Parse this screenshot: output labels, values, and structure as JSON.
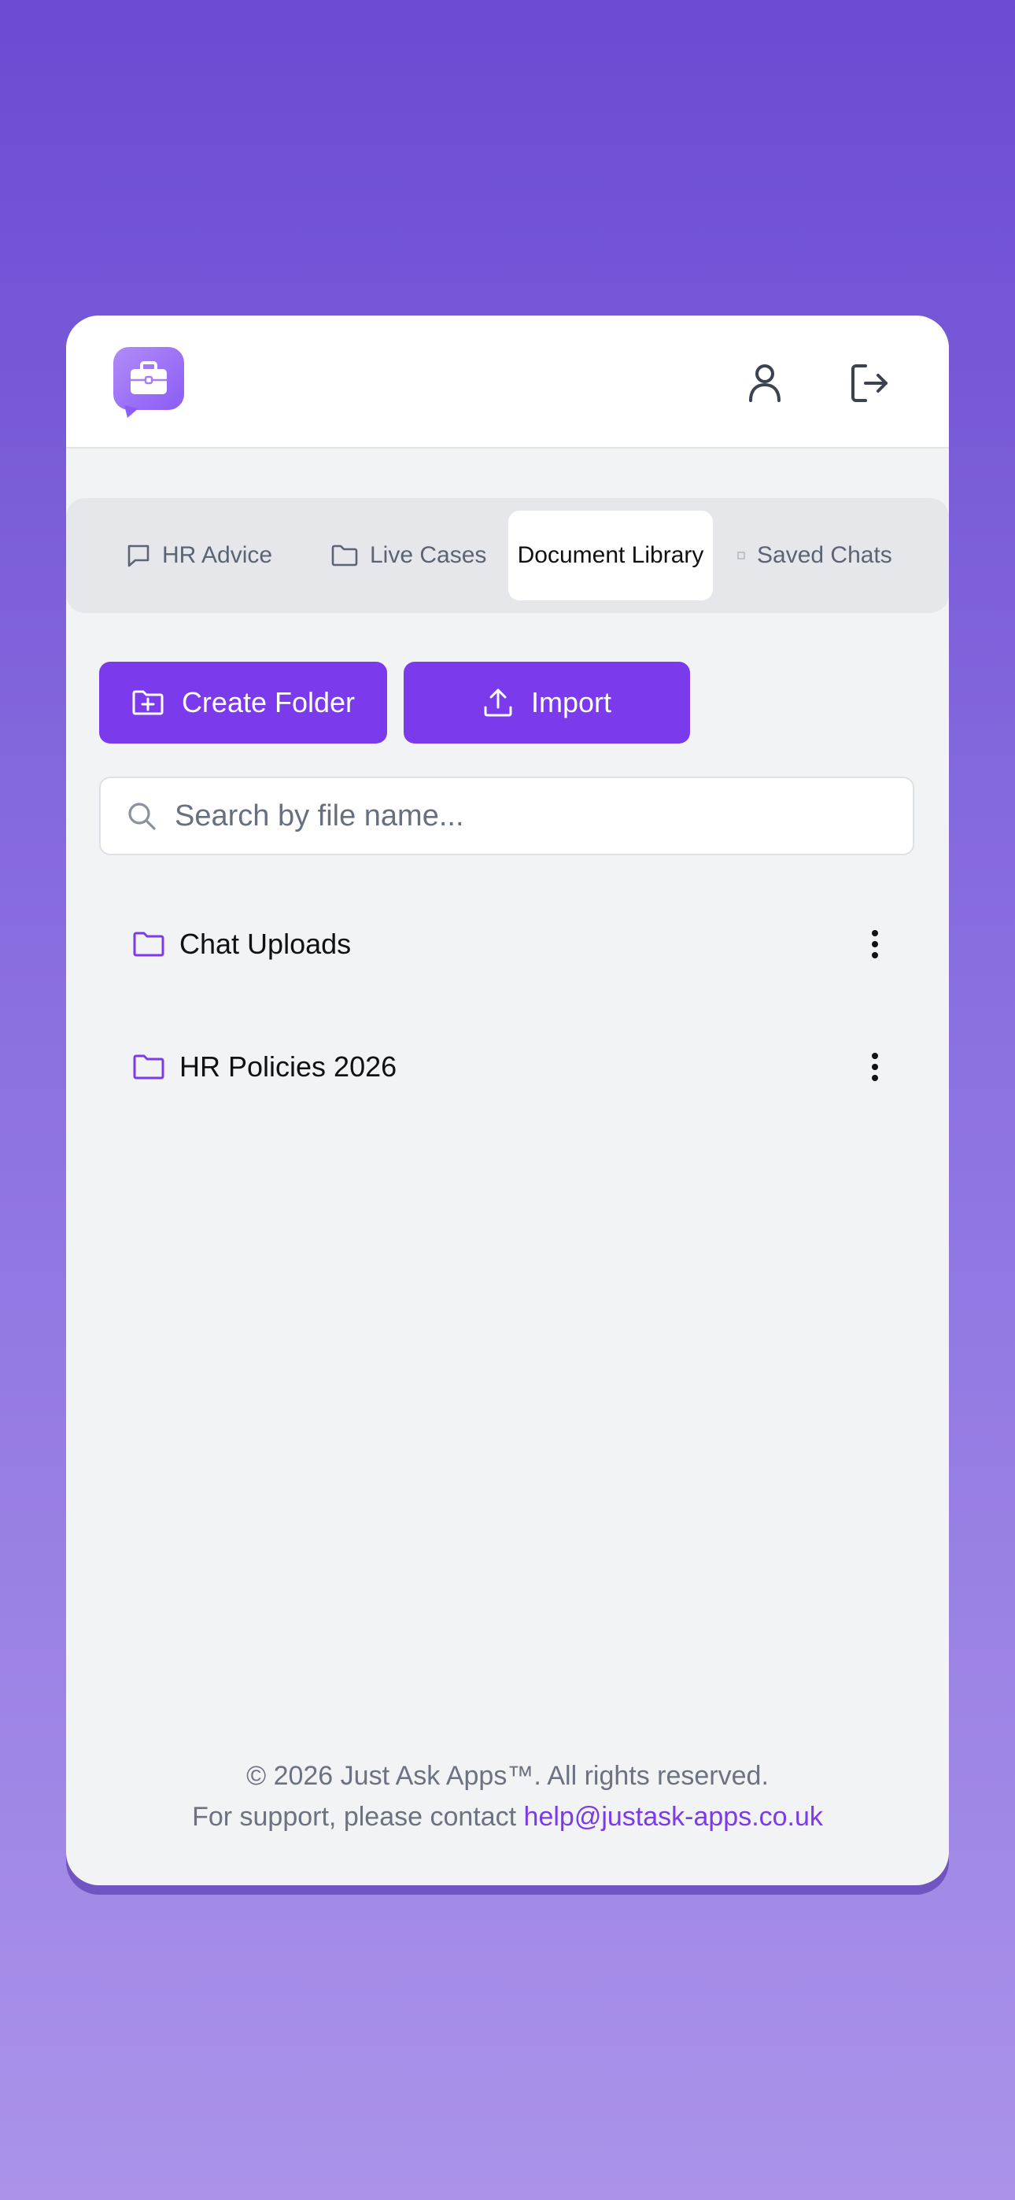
{
  "header": {
    "logo_icon": "briefcase-chat-icon",
    "profile_icon": "user-icon",
    "logout_icon": "logout-icon"
  },
  "tabs": [
    {
      "label": "HR Advice",
      "icon": "chat-bubble-icon",
      "active": false
    },
    {
      "label": "Live Cases",
      "icon": "folder-icon",
      "active": false
    },
    {
      "label": "Document Library",
      "icon": "",
      "active": true
    },
    {
      "label": "Saved Chats",
      "icon": "bookmark-icon",
      "active": false
    }
  ],
  "actions": {
    "create_folder_label": "Create Folder",
    "import_label": "Import"
  },
  "search": {
    "placeholder": "Search by file name..."
  },
  "folders": [
    {
      "name": "Chat Uploads"
    },
    {
      "name": "HR Policies 2026"
    }
  ],
  "footer": {
    "copyright": "© 2026 Just Ask Apps™. All rights reserved.",
    "support_prefix": "For support, please contact ",
    "support_email": "help@justask-apps.co.uk"
  },
  "colors": {
    "accent": "#7c3aed",
    "background_top": "#6b4bd2",
    "background_bottom": "#aa93e9"
  }
}
